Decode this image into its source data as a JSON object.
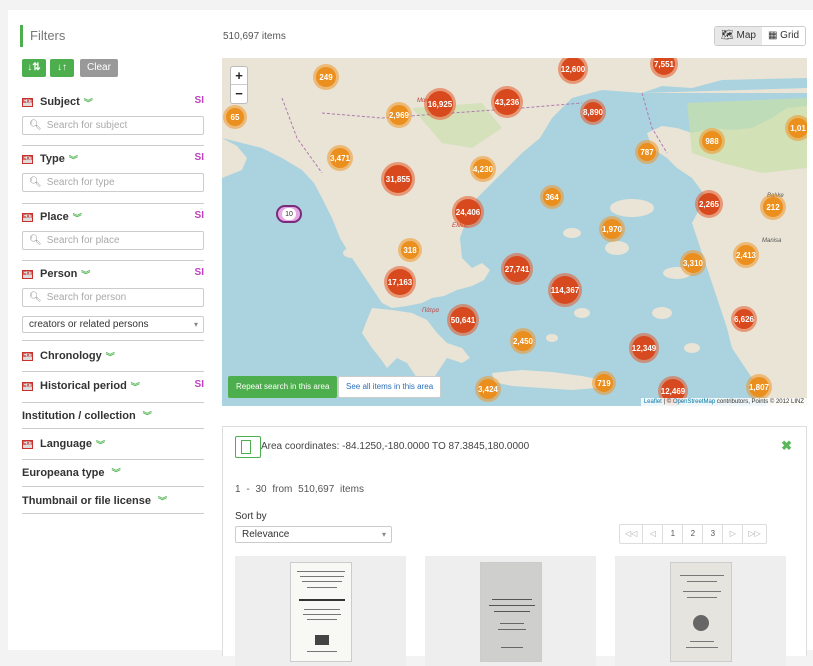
{
  "sidebar": {
    "title": "Filters",
    "sort_asc_icon": "↓⇅",
    "sort_desc_icon": "↓↑",
    "clear_label": "Clear",
    "ext_badge": "EXT",
    "facets": [
      {
        "label": "Subject",
        "si": "SI",
        "search_placeholder": "Search for subject"
      },
      {
        "label": "Type",
        "si": "SI",
        "search_placeholder": "Search for type"
      },
      {
        "label": "Place",
        "si": "SI",
        "search_placeholder": "Search for place"
      },
      {
        "label": "Person",
        "si": "SI",
        "search_placeholder": "Search for person"
      }
    ],
    "person_role_select": "creators or related persons",
    "chronology": "Chronology",
    "historical_period": "Historical period",
    "historical_period_si": "SI",
    "institution": "Institution / collection",
    "language": "Language",
    "europeana_type": "Europeana type",
    "thumbnail_license": "Thumbnail or file license"
  },
  "header": {
    "items_count": "510,697  items",
    "view_map": "Map",
    "view_grid": "Grid"
  },
  "map": {
    "zoom_in": "+",
    "zoom_out": "−",
    "repeat_search": "Repeat search in this area",
    "see_all": "See all items in this area",
    "attribution_leaflet": "Leaflet",
    "attribution_osm": "OpenStreetMap",
    "attribution_rest": "contributors, Points © 2012 LINZ",
    "clusters": [
      "249",
      "12,600",
      "7,551",
      "65",
      "2,969",
      "16,925",
      "43,236",
      "8,890",
      "1,01",
      "988",
      "787",
      "3,471",
      "31,855",
      "4,230",
      "364",
      "24,406",
      "2,265",
      "212",
      "10",
      "1,970",
      "318",
      "27,741",
      "3,310",
      "2,413",
      "17,163",
      "114,367",
      "6,626",
      "50,641",
      "2,450",
      "12,349",
      "3,424",
      "719",
      "12,469",
      "1,807"
    ]
  },
  "results": {
    "area_coordinates": "Area coordinates: -84.1250,-180.0000 TO 87.3845,180.0000",
    "range": "1 - 30 from 510,697 items",
    "sort_by_label": "Sort by",
    "sort_value": "Relevance",
    "pager": [
      "◁◁",
      "◁",
      "1",
      "2",
      "3",
      "▷",
      "▷▷"
    ]
  }
}
